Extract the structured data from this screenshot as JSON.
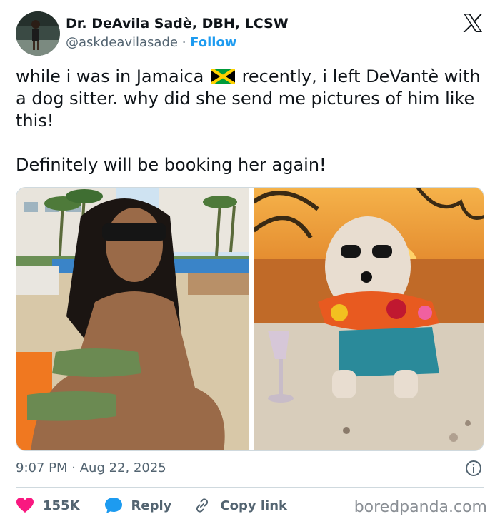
{
  "author": {
    "name": "Dr. DeAvila Sadè, DBH, LCSW",
    "handle": "@askdeavilasade",
    "separator": "·",
    "follow_label": "Follow"
  },
  "tweet": {
    "line1_before_flag": "while i was in Jamaica",
    "line1_after_flag": "recently, i left DeVantè with a dog sitter. why did she send me pictures of him like this!",
    "line2": "Definitely will be booking her again!",
    "flag_icon": "jamaica-flag-icon"
  },
  "meta": {
    "time": "9:07 PM",
    "separator": "·",
    "date": "Aug 22, 2025"
  },
  "actions": {
    "likes": "155K",
    "reply_label": "Reply",
    "copy_label": "Copy link"
  },
  "watermark": "boredpanda.com",
  "colors": {
    "accent": "#1d9bf0",
    "like": "#f91880",
    "muted": "#536471"
  }
}
